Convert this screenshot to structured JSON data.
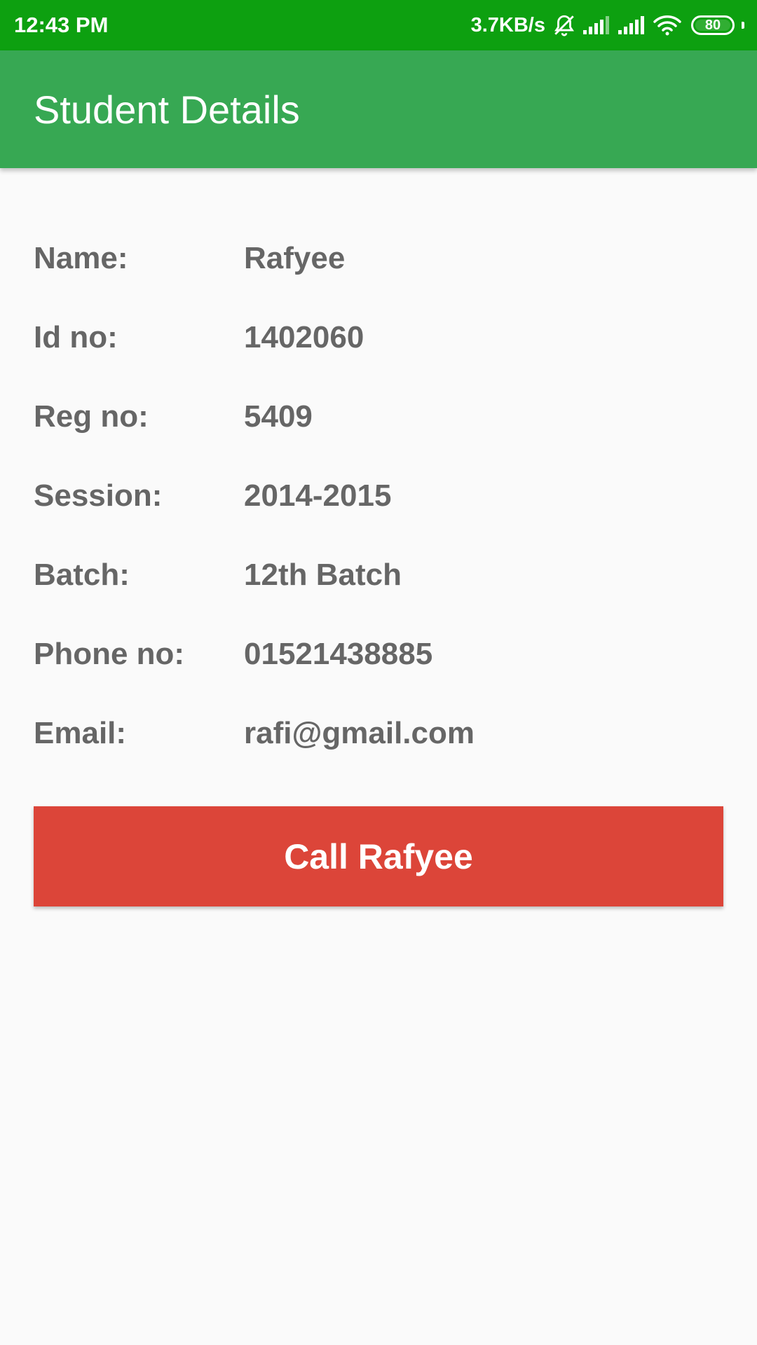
{
  "status_bar": {
    "time": "12:43 PM",
    "net_speed": "3.7KB/s",
    "icons": [
      "alarm-off-icon",
      "signal-icon-1",
      "signal-icon-2",
      "wifi-icon",
      "battery-icon"
    ],
    "battery_level": "80",
    "color": "#0da010"
  },
  "app_bar": {
    "title": "Student Details",
    "color": "#37a853"
  },
  "details": [
    {
      "label": "Name:",
      "value": "Rafyee"
    },
    {
      "label": "Id no:",
      "value": "1402060"
    },
    {
      "label": "Reg no:",
      "value": "5409"
    },
    {
      "label": "Session:",
      "value": "2014-2015"
    },
    {
      "label": "Batch:",
      "value": "12th Batch"
    },
    {
      "label": "Phone no:",
      "value": "01521438885"
    },
    {
      "label": "Email:",
      "value": "rafi@gmail.com"
    }
  ],
  "call_button": {
    "label": "Call Rafyee",
    "color": "#dc4539"
  }
}
